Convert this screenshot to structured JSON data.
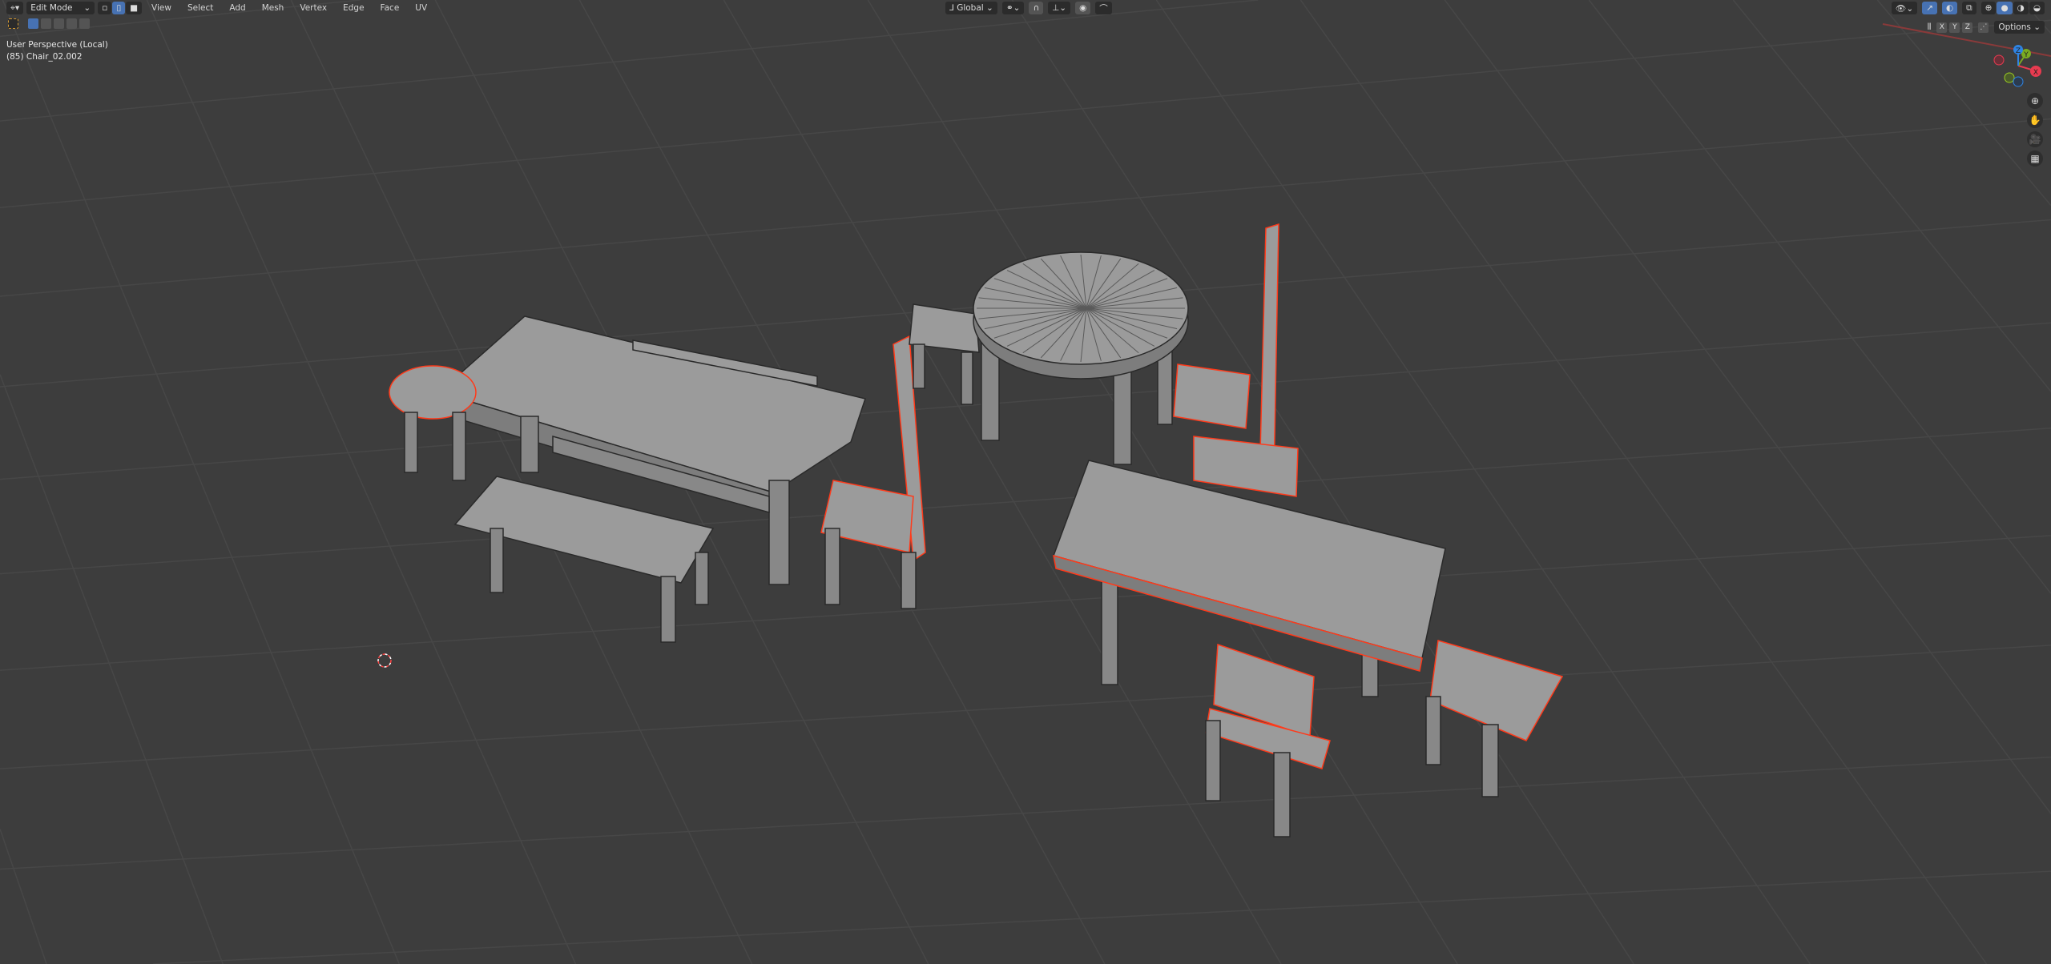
{
  "header": {
    "editor_type_icon": "3d-viewport-icon",
    "mode": "Edit Mode",
    "menus": [
      "View",
      "Select",
      "Add",
      "Mesh",
      "Vertex",
      "Edge",
      "Face",
      "UV"
    ],
    "transform_orientation": "Global",
    "options_label": "Options",
    "axis_labels": [
      "X",
      "Y",
      "Z"
    ]
  },
  "overlay": {
    "view_name": "User Perspective (Local)",
    "object_info": "(85) Chair_02.002"
  },
  "gizmo": {
    "x": "X",
    "y": "Y",
    "z": "Z",
    "x_color": "#e83b50",
    "y_color": "#7aab22",
    "z_color": "#2f84e3"
  },
  "colors": {
    "background": "#3d3d3d",
    "mesh": "#9a9a9a",
    "selected_edge": "#ff3a1a",
    "active_button": "#4772b3"
  }
}
